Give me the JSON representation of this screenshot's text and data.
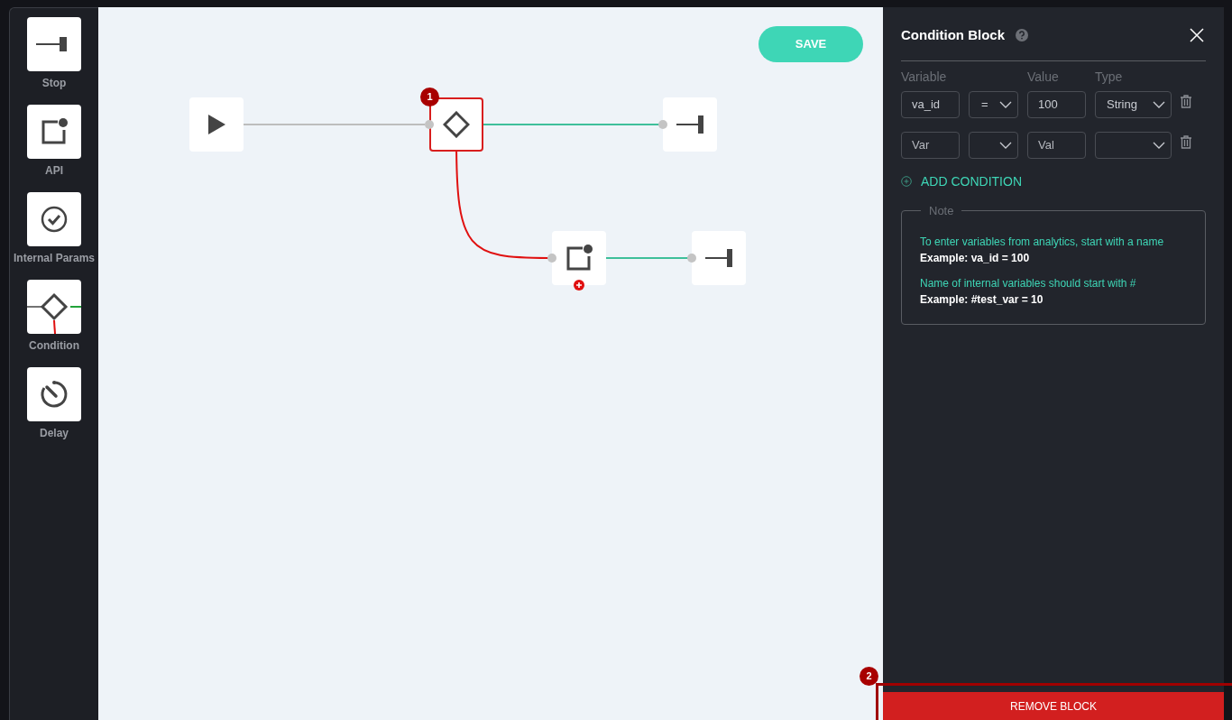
{
  "palette": [
    {
      "label": "Stop",
      "kind": "stop"
    },
    {
      "label": "API",
      "kind": "api"
    },
    {
      "label": "Internal Params",
      "kind": "params"
    },
    {
      "label": "Condition",
      "kind": "condition"
    },
    {
      "label": "Delay",
      "kind": "delay"
    }
  ],
  "canvas": {
    "save_button": "SAVE",
    "annotation": "1",
    "nodes": [
      {
        "kind": "start",
        "selected": false
      },
      {
        "kind": "condition",
        "selected": true
      },
      {
        "kind": "stop",
        "selected": false
      },
      {
        "kind": "api",
        "selected": false
      },
      {
        "kind": "stop",
        "selected": false
      }
    ]
  },
  "panel": {
    "title": "Condition Block",
    "columns": [
      "Variable",
      "Value",
      "Type"
    ],
    "conditions": [
      {
        "variable": "va_id",
        "operator": "=",
        "value": "100",
        "type": "String"
      },
      {
        "variable_placeholder": "Var",
        "value_placeholder": "Val"
      }
    ],
    "add_condition": "ADD CONDITION",
    "note": {
      "legend": "Note",
      "lines": [
        {
          "kind": "hint",
          "text": "To enter variables from analytics, start with a name"
        },
        {
          "kind": "example",
          "text": "Example: va_id = 100"
        },
        {
          "kind": "hint",
          "text": "Name of internal variables should start with #"
        },
        {
          "kind": "example",
          "text": "Example: #test_var = 10"
        }
      ]
    },
    "remove_button": "REMOVE BLOCK",
    "annotation": "2"
  }
}
